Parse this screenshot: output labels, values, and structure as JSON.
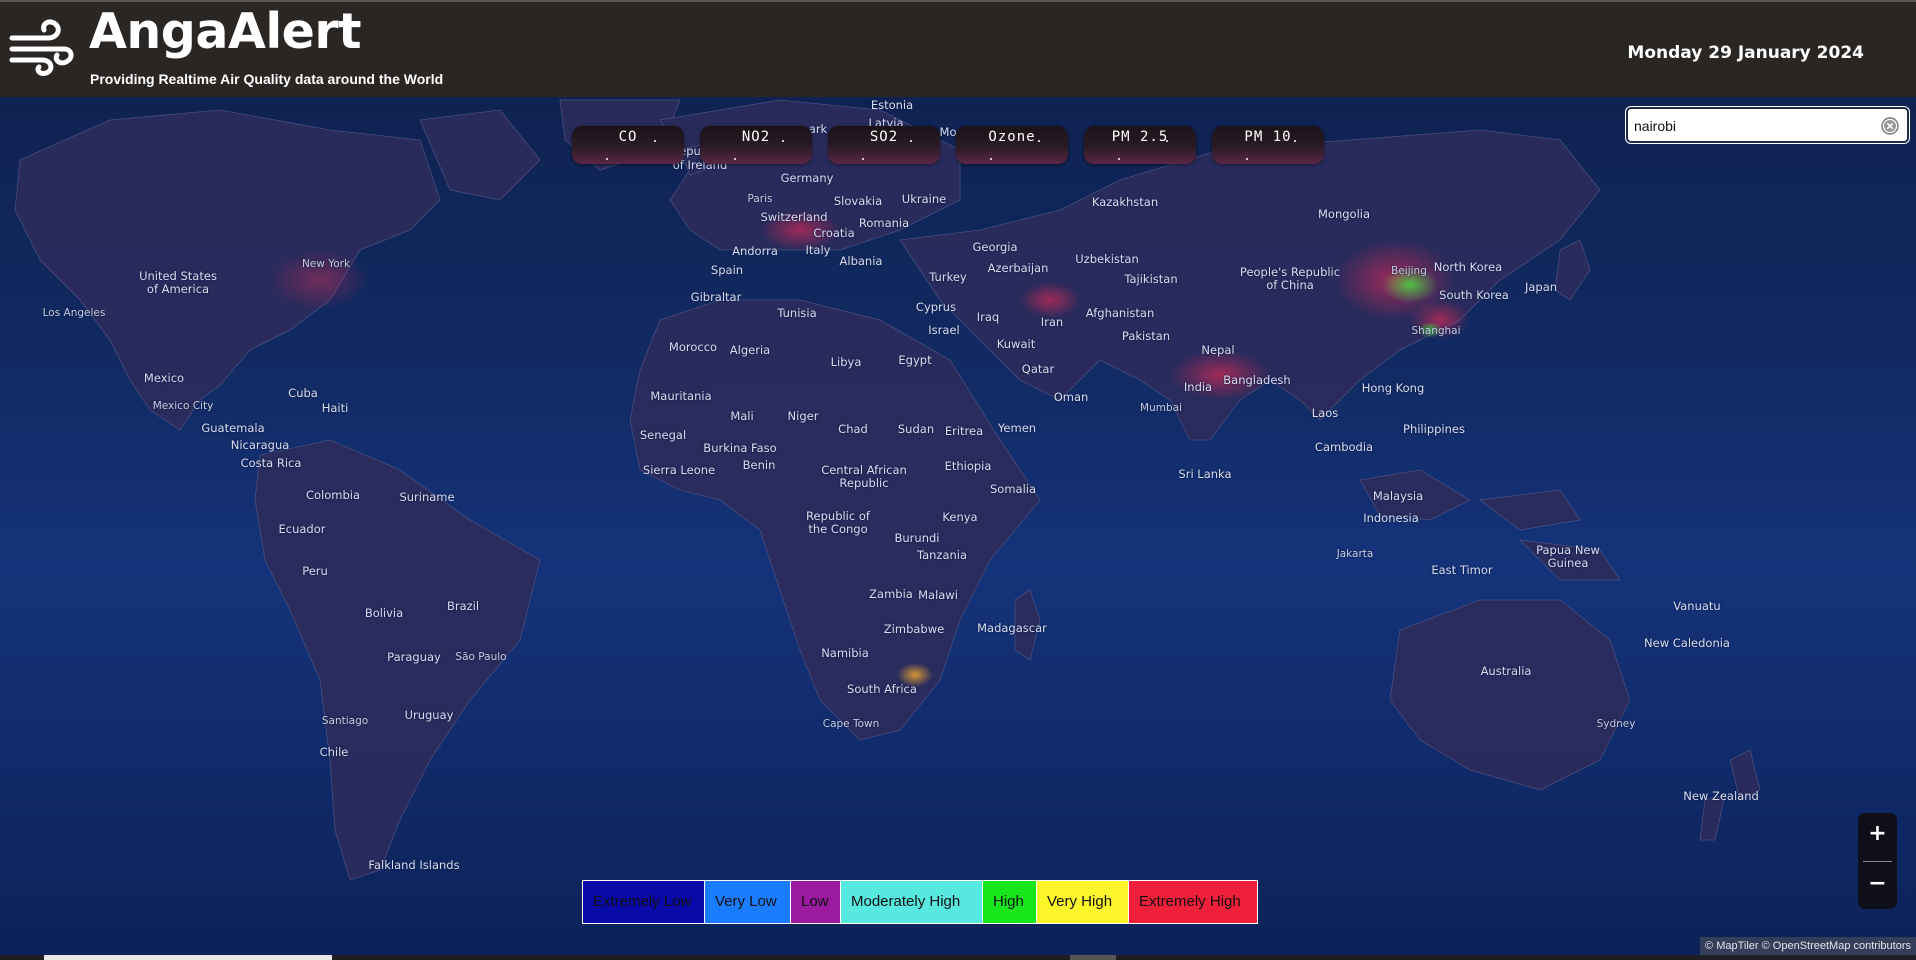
{
  "header": {
    "title": "AngaAlert",
    "subtitle": "Providing Realtime Air Quality data around the World",
    "date": "Monday 29 January 2024",
    "logo_icon": "wind-icon"
  },
  "pollutants": [
    "CO",
    "NO2",
    "SO2",
    "Ozone",
    "PM 2.5",
    "PM 10"
  ],
  "search": {
    "value": "nairobi",
    "clear_icon": "clear-icon"
  },
  "legend": [
    {
      "label": "Extremely Low",
      "color": "#0a0aa8"
    },
    {
      "label": "Very Low",
      "color": "#1a7cff"
    },
    {
      "label": "Low",
      "color": "#9a1aa0"
    },
    {
      "label": "Moderately High",
      "color": "#57e8e0"
    },
    {
      "label": "High",
      "color": "#17e61a"
    },
    {
      "label": "Very High",
      "color": "#fbf52a"
    },
    {
      "label": "Extremely High",
      "color": "#f0203a"
    }
  ],
  "zoom": {
    "in": "+",
    "out": "−"
  },
  "attribution": "© MapTiler © OpenStreetMap contributors",
  "map_labels": {
    "estonia": "Estonia",
    "latvia": "Latvia",
    "ireland": "of Ireland",
    "germany": "Germany",
    "paris": "Paris",
    "slovakia": "Slovakia",
    "ukraine": "Ukraine",
    "switzerland": "Switzerland",
    "romania": "Romania",
    "croatia": "Croatia",
    "andorra": "Andorra",
    "italy": "Italy",
    "spain": "Spain",
    "albania": "Albania",
    "gibraltar": "Gibraltar",
    "tunisia": "Tunisia",
    "georgia": "Georgia",
    "azerbaijan": "Azerbaijan",
    "turkey": "Turkey",
    "cyprus": "Cyprus",
    "israel": "Israel",
    "iraq": "Iraq",
    "iran": "Iran",
    "kuwait": "Kuwait",
    "qatar": "Qatar",
    "oman": "Oman",
    "yemen": "Yemen",
    "egypt": "Egypt",
    "libya": "Libya",
    "morocco": "Morocco",
    "algeria": "Algeria",
    "mauritania": "Mauritania",
    "mali": "Mali",
    "niger": "Niger",
    "chad": "Chad",
    "sudan": "Sudan",
    "eritrea": "Eritrea",
    "senegal": "Senegal",
    "burkina": "Burkina Faso",
    "benin": "Benin",
    "sierra": "Sierra Leone",
    "car": "Central African\nRepublic",
    "ethiopia": "Ethiopia",
    "somalia": "Somalia",
    "congo": "Republic of\nthe Congo",
    "kenya": "Kenya",
    "burundi": "Burundi",
    "tanzania": "Tanzania",
    "zambia": "Zambia",
    "malawi": "Malawi",
    "zimbabwe": "Zimbabwe",
    "madagascar": "Madagascar",
    "namibia": "Namibia",
    "southafrica": "South Africa",
    "capetown": "Cape Town",
    "kazakhstan": "Kazakhstan",
    "mongolia": "Mongolia",
    "uzbekistan": "Uzbekistan",
    "tajikistan": "Tajikistan",
    "afghanistan": "Afghanistan",
    "pakistan": "Pakistan",
    "nepal": "Nepal",
    "india": "India",
    "mumbai": "Mumbai",
    "bangladesh": "Bangladesh",
    "srilanka": "Sri Lanka",
    "china": "People's Republic\nof China",
    "beijing": "Beijing",
    "northkorea": "North Korea",
    "southkorea": "South Korea",
    "japan": "Japan",
    "shanghai": "Shanghai",
    "hongkong": "Hong Kong",
    "laos": "Laos",
    "cambodia": "Cambodia",
    "philippines": "Philippines",
    "malaysia": "Malaysia",
    "indonesia": "Indonesia",
    "jakarta": "Jakarta",
    "easttimor": "East Timor",
    "png": "Papua New\nGuinea",
    "vanuatu": "Vanuatu",
    "newcaledonia": "New Caledonia",
    "australia": "Australia",
    "sydney": "Sydney",
    "newzealand": "New Zealand",
    "usa": "United States\nof America",
    "newyork": "New York",
    "losangeles": "Los Angeles",
    "mexico": "Mexico",
    "mexicocity": "Mexico City",
    "cuba": "Cuba",
    "haiti": "Haiti",
    "guatemala": "Guatemala",
    "nicaragua": "Nicaragua",
    "costarica": "Costa Rica",
    "colombia": "Colombia",
    "suriname": "Suriname",
    "ecuador": "Ecuador",
    "peru": "Peru",
    "brazil": "Brazil",
    "bolivia": "Bolivia",
    "paraguay": "Paraguay",
    "saopaulo": "São Paulo",
    "santiago": "Santiago",
    "uruguay": "Uruguay",
    "chile": "Chile",
    "falkland": "Falkland Islands",
    "mo": "Mo",
    "park": "ark",
    "repu": "epu"
  }
}
